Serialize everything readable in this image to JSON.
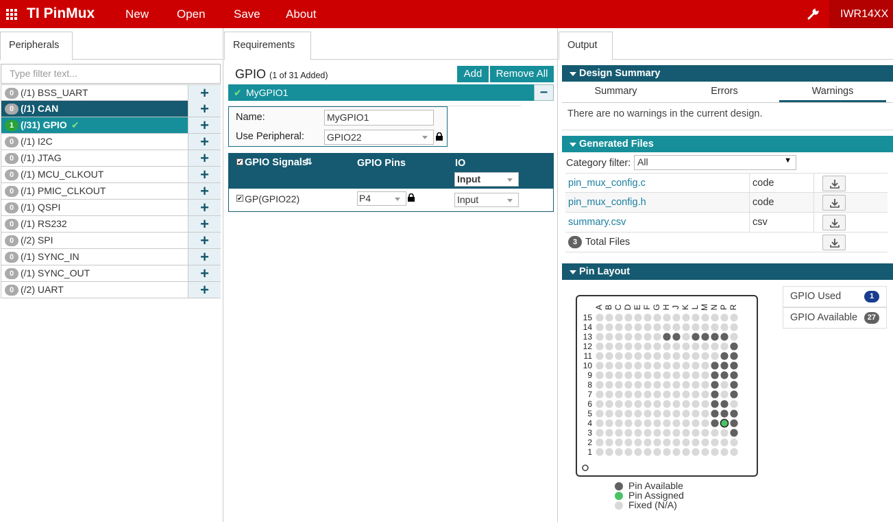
{
  "app": {
    "title": "TI PinMux",
    "menu": [
      "New",
      "Open",
      "Save",
      "About"
    ],
    "device": "IWR14XX"
  },
  "left": {
    "tab": "Peripherals",
    "filter_placeholder": "Type filter text...",
    "peripherals": [
      {
        "count": "0",
        "label": "(/1) BSS_UART",
        "state": ""
      },
      {
        "count": "0",
        "label": "(/1) CAN",
        "state": "sel-dark"
      },
      {
        "count": "1",
        "label": "(/31) GPIO",
        "state": "sel-teal"
      },
      {
        "count": "0",
        "label": "(/1) I2C",
        "state": ""
      },
      {
        "count": "0",
        "label": "(/1) JTAG",
        "state": ""
      },
      {
        "count": "0",
        "label": "(/1) MCU_CLKOUT",
        "state": ""
      },
      {
        "count": "0",
        "label": "(/1) PMIC_CLKOUT",
        "state": ""
      },
      {
        "count": "0",
        "label": "(/1) QSPI",
        "state": ""
      },
      {
        "count": "0",
        "label": "(/1) RS232",
        "state": ""
      },
      {
        "count": "0",
        "label": "(/2) SPI",
        "state": ""
      },
      {
        "count": "0",
        "label": "(/1) SYNC_IN",
        "state": ""
      },
      {
        "count": "0",
        "label": "(/1) SYNC_OUT",
        "state": ""
      },
      {
        "count": "0",
        "label": "(/2) UART",
        "state": ""
      }
    ]
  },
  "mid": {
    "tab": "Requirements",
    "title": "GPIO",
    "subtitle": "(1 of 31 Added)",
    "add_label": "Add",
    "remove_all_label": "Remove All",
    "instance_name": "MyGPIO1",
    "collapse_symbol": "−",
    "name_label": "Name:",
    "name_value": "MyGPIO1",
    "peripheral_label": "Use Peripheral:",
    "peripheral_value": "GPIO22",
    "col_signals": "GPIO Signals",
    "col_pins": "GPIO Pins",
    "col_io": "IO",
    "header_io_value": "Input",
    "signal_name": "GP(GPIO22)",
    "signal_pin": "P4",
    "signal_io": "Input"
  },
  "right": {
    "tab": "Output",
    "design_summary": "Design Summary",
    "subtabs": [
      "Summary",
      "Errors",
      "Warnings"
    ],
    "active_subtab": "Warnings",
    "warnings_text": "There are no warnings in the current design.",
    "generated_files": "Generated Files",
    "category_label": "Category filter:",
    "category_value": "All",
    "files": [
      {
        "name": "pin_mux_config.c",
        "type": "code"
      },
      {
        "name": "pin_mux_config.h",
        "type": "code"
      },
      {
        "name": "summary.csv",
        "type": "csv"
      }
    ],
    "total_count": "3",
    "total_label": "Total Files",
    "pin_layout": "Pin Layout",
    "gpio_used_label": "GPIO Used",
    "gpio_used_count": "1",
    "gpio_available_label": "GPIO Available",
    "gpio_available_count": "27",
    "columns": [
      "A",
      "B",
      "C",
      "D",
      "E",
      "F",
      "G",
      "H",
      "J",
      "K",
      "L",
      "M",
      "N",
      "P",
      "R"
    ],
    "rows": [
      "15",
      "14",
      "13",
      "12",
      "11",
      "10",
      "9",
      "8",
      "7",
      "6",
      "5",
      "4",
      "3",
      "2",
      "1"
    ],
    "legend": [
      "Pin Available",
      "Pin Assigned",
      "Fixed (N/A)"
    ],
    "colors": {
      "available": "#616161",
      "assigned": "#4cc266",
      "fixed": "#d9d9d9"
    },
    "available_pins": [
      "H13",
      "J13",
      "L13",
      "M13",
      "N13",
      "P13",
      "R12",
      "P11",
      "R11",
      "N10",
      "P10",
      "R10",
      "N9",
      "P9",
      "R9",
      "N8",
      "R8",
      "N7",
      "R7",
      "N6",
      "P6",
      "N5",
      "P5",
      "R5",
      "N4",
      "R4",
      "R3"
    ],
    "assigned_pins": [
      "P4"
    ]
  }
}
